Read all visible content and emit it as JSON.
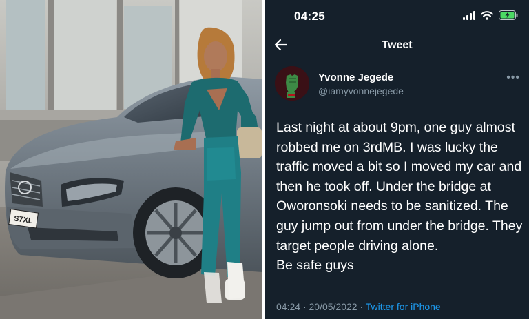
{
  "status_bar": {
    "time": "04:25"
  },
  "nav": {
    "title": "Tweet"
  },
  "tweet": {
    "author_name": "Yvonne Jegede",
    "author_handle": "@iamyvonnejegede",
    "text": "Last night at about 9pm, one guy almost robbed me on 3rdMB. I was lucky the traffic moved a bit so I moved my car and then he took off. Under the bridge at Oworonsoki needs to be sanitized. The guy jump out from under the bridge. They target people driving alone.\nBe safe guys",
    "time": "04:24",
    "separator": "·",
    "date": "20/05/2022",
    "source": "Twitter for iPhone"
  },
  "photo": {
    "plate_text": "S7XL"
  },
  "icons": {
    "back": "arrow-left-icon",
    "more": "more-icon",
    "signal": "signal-icon",
    "wifi": "wifi-icon",
    "battery": "battery-charging-icon"
  },
  "colors": {
    "tweet_background": "#15202b",
    "secondary_text": "#8899a6",
    "link": "#1d9bf0",
    "battery_fill": "#4cd964",
    "avatar_badge": "#b5121b"
  }
}
